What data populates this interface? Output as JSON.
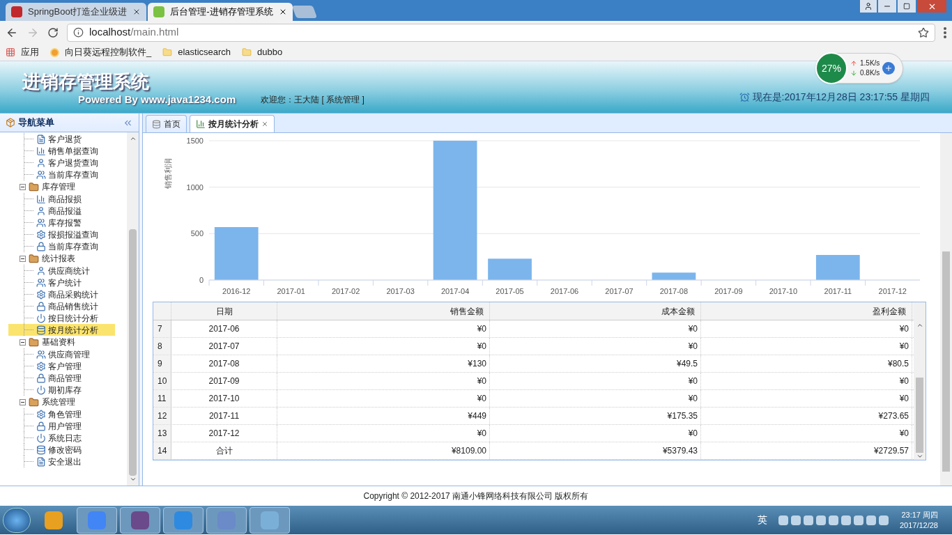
{
  "browser": {
    "tabs": [
      {
        "title": "SpringBoot打造企业级进",
        "selected": false
      },
      {
        "title": "后台管理-进销存管理系统",
        "selected": true
      }
    ],
    "url_host": "localhost",
    "url_path": "/main.html",
    "bookmarks": [
      {
        "label": "应用"
      },
      {
        "label": "向日葵远程控制软件_"
      },
      {
        "label": "elasticsearch"
      },
      {
        "label": "dubbo"
      }
    ]
  },
  "net_widget": {
    "percent": "27%",
    "up": "1.5K/s",
    "down": "0.8K/s"
  },
  "header": {
    "title": "进销存管理系统",
    "powered": "Powered By www.java1234.com",
    "welcome": "欢迎您：王大陆 [ 系统管理 ]",
    "clock": "现在是:2017年12月28日 23:17:55 星期四"
  },
  "sidebar": {
    "title": "导航菜单",
    "items": [
      {
        "children": [
          {
            "label": "客户退货",
            "selected": false
          },
          {
            "label": "销售单据查询",
            "selected": false
          },
          {
            "label": "客户退货查询",
            "selected": false
          },
          {
            "label": "当前库存查询",
            "selected": false
          }
        ]
      },
      {
        "label": "库存管理",
        "expanded": true,
        "children": [
          {
            "label": "商品报损",
            "selected": false
          },
          {
            "label": "商品报溢",
            "selected": false
          },
          {
            "label": "库存报警",
            "selected": false
          },
          {
            "label": "报损报溢查询",
            "selected": false
          },
          {
            "label": "当前库存查询",
            "selected": false
          }
        ]
      },
      {
        "label": "统计报表",
        "expanded": true,
        "children": [
          {
            "label": "供应商统计",
            "selected": false
          },
          {
            "label": "客户统计",
            "selected": false
          },
          {
            "label": "商品采购统计",
            "selected": false
          },
          {
            "label": "商品销售统计",
            "selected": false
          },
          {
            "label": "按日统计分析",
            "selected": false
          },
          {
            "label": "按月统计分析",
            "selected": true
          }
        ]
      },
      {
        "label": "基础资料",
        "expanded": true,
        "children": [
          {
            "label": "供应商管理",
            "selected": false
          },
          {
            "label": "客户管理",
            "selected": false
          },
          {
            "label": "商品管理",
            "selected": false
          },
          {
            "label": "期初库存",
            "selected": false
          }
        ]
      },
      {
        "label": "系统管理",
        "expanded": true,
        "children": [
          {
            "label": "角色管理",
            "selected": false
          },
          {
            "label": "用户管理",
            "selected": false
          },
          {
            "label": "系统日志",
            "selected": false
          },
          {
            "label": "修改密码",
            "selected": false
          },
          {
            "label": "安全退出",
            "selected": false
          }
        ]
      }
    ]
  },
  "content_tabs": [
    {
      "label": "首页",
      "closable": false,
      "selected": false
    },
    {
      "label": "按月统计分析",
      "closable": true,
      "selected": true
    }
  ],
  "chart": {
    "chart_data": {
      "type": "bar",
      "ylabel": "销售利润",
      "categories": [
        "2016-12",
        "2017-01",
        "2017-02",
        "2017-03",
        "2017-04",
        "2017-05",
        "2017-06",
        "2017-07",
        "2017-08",
        "2017-09",
        "2017-10",
        "2017-11",
        "2017-12"
      ],
      "series": [
        {
          "color": "#7cb5ec",
          "values": [
            570,
            0,
            0,
            0,
            1500,
            230,
            0,
            0,
            80,
            0,
            0,
            270,
            0
          ]
        }
      ],
      "grid": true,
      "ylim": [
        0,
        1500
      ],
      "yticks": [
        0,
        500,
        1000,
        1500
      ]
    }
  },
  "table": {
    "columns": [
      "日期",
      "销售金额",
      "成本金额",
      "盈利金额"
    ],
    "rows": [
      {
        "num": "7",
        "date": "2017-06",
        "sales": "¥0",
        "cost": "¥0",
        "profit": "¥0"
      },
      {
        "num": "8",
        "date": "2017-07",
        "sales": "¥0",
        "cost": "¥0",
        "profit": "¥0"
      },
      {
        "num": "9",
        "date": "2017-08",
        "sales": "¥130",
        "cost": "¥49.5",
        "profit": "¥80.5"
      },
      {
        "num": "10",
        "date": "2017-09",
        "sales": "¥0",
        "cost": "¥0",
        "profit": "¥0"
      },
      {
        "num": "11",
        "date": "2017-10",
        "sales": "¥0",
        "cost": "¥0",
        "profit": "¥0"
      },
      {
        "num": "12",
        "date": "2017-11",
        "sales": "¥449",
        "cost": "¥175.35",
        "profit": "¥273.65"
      },
      {
        "num": "13",
        "date": "2017-12",
        "sales": "¥0",
        "cost": "¥0",
        "profit": "¥0"
      },
      {
        "num": "14",
        "date": "合计",
        "sales": "¥8109.00",
        "cost": "¥5379.43",
        "profit": "¥2729.57"
      }
    ]
  },
  "footer": "Copyright © 2012-2017 南通小锋网络科技有限公司 版权所有",
  "taskbar": {
    "ime": "英",
    "time": "23:17 周四",
    "date": "2017/12/28"
  }
}
